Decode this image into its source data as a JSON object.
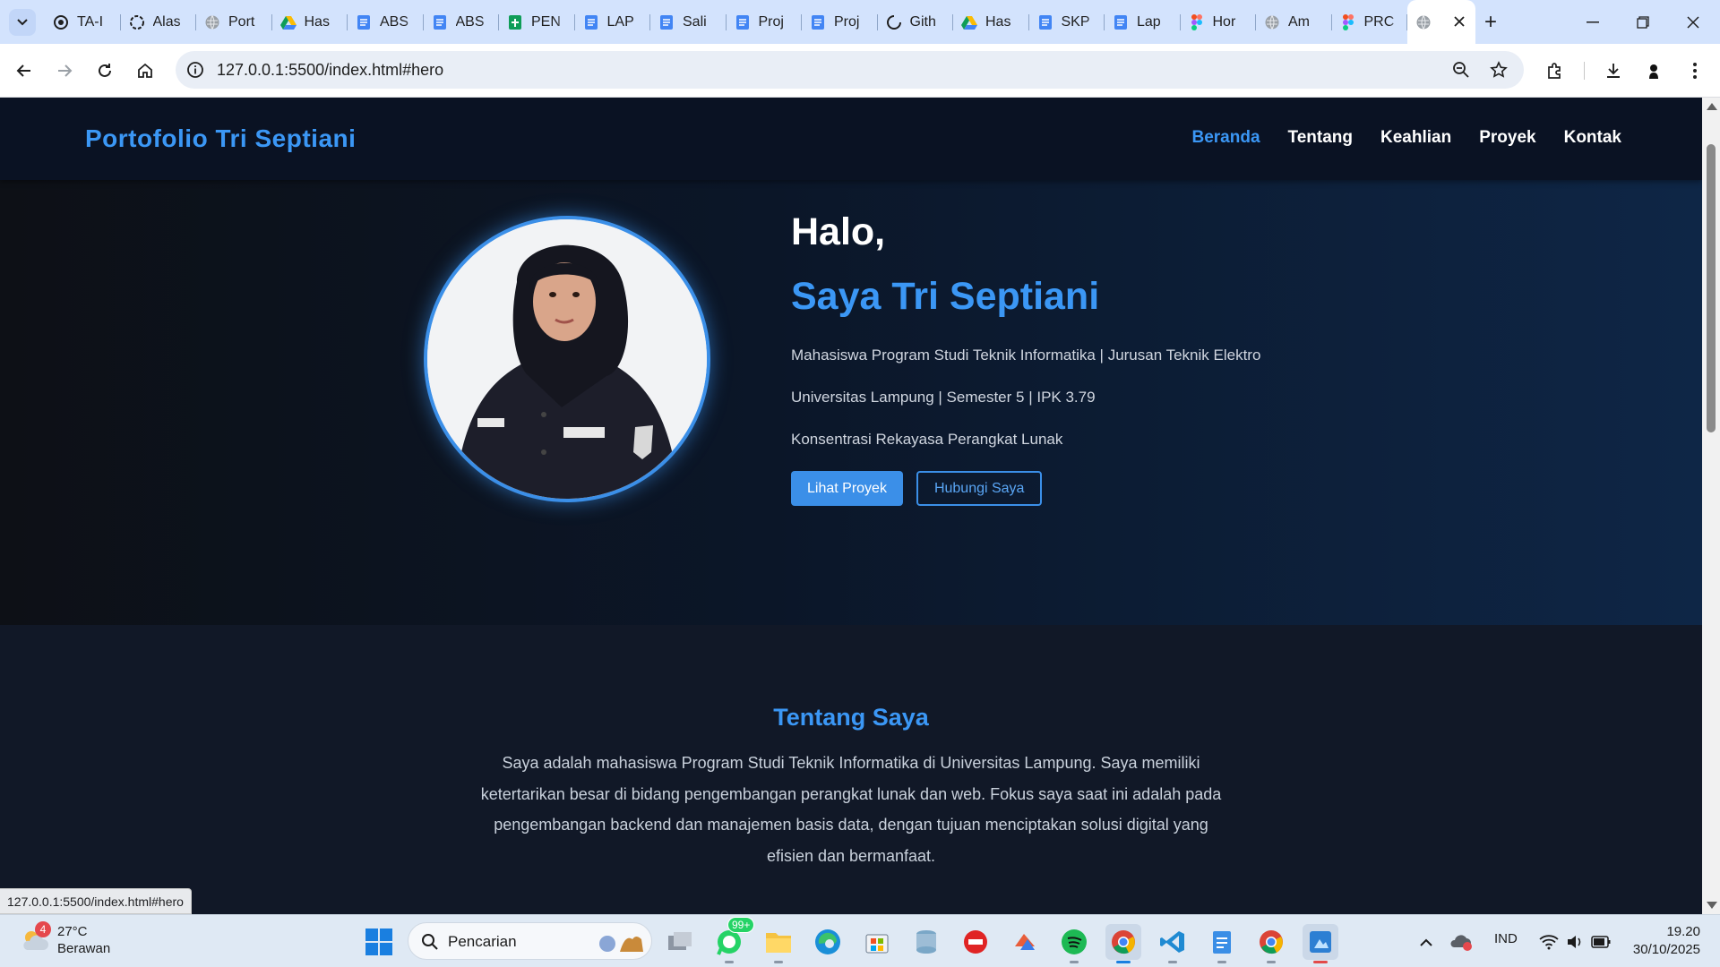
{
  "browser": {
    "tabs": [
      {
        "title": "TA-I",
        "icon": "github-copilot-icon"
      },
      {
        "title": "Alas",
        "icon": "chatgpt-icon"
      },
      {
        "title": "Port",
        "icon": "globe-icon"
      },
      {
        "title": "Has",
        "icon": "google-drive-icon"
      },
      {
        "title": "ABS",
        "icon": "google-docs-icon"
      },
      {
        "title": "ABS",
        "icon": "google-docs-icon"
      },
      {
        "title": "PEN",
        "icon": "google-sheets-icon"
      },
      {
        "title": "LAP",
        "icon": "google-docs-icon"
      },
      {
        "title": "Sali",
        "icon": "google-docs-icon"
      },
      {
        "title": "Proj",
        "icon": "google-docs-icon"
      },
      {
        "title": "Proj",
        "icon": "google-docs-icon"
      },
      {
        "title": "Gith",
        "icon": "loading-icon"
      },
      {
        "title": "Has",
        "icon": "google-drive-icon"
      },
      {
        "title": "SKP",
        "icon": "google-docs-icon"
      },
      {
        "title": "Lap",
        "icon": "google-docs-icon"
      },
      {
        "title": "Hor",
        "icon": "figma-icon"
      },
      {
        "title": "Am",
        "icon": "globe-icon"
      },
      {
        "title": "PRC",
        "icon": "figma-icon"
      }
    ],
    "active_tab_icon": "globe-icon",
    "url": "127.0.0.1:5500/index.html#hero",
    "status_url": "127.0.0.1:5500/index.html#hero"
  },
  "site": {
    "logo": "Portofolio Tri Septiani",
    "nav": [
      "Beranda",
      "Tentang",
      "Keahlian",
      "Proyek",
      "Kontak"
    ],
    "hero": {
      "greeting": "Halo,",
      "name": "Saya Tri Septiani",
      "line1": "Mahasiswa Program Studi Teknik Informatika | Jurusan Teknik Elektro",
      "line2": "Universitas Lampung | Semester 5 | IPK 3.79",
      "line3": "Konsentrasi Rekayasa Perangkat Lunak",
      "btn_primary": "Lihat Proyek",
      "btn_secondary": "Hubungi Saya"
    },
    "about": {
      "title": "Tentang Saya",
      "text": "Saya adalah mahasiswa Program Studi Teknik Informatika di Universitas Lampung. Saya memiliki ketertarikan besar di bidang pengembangan perangkat lunak dan web. Fokus saya saat ini adalah pada pengembangan backend dan manajemen basis data, dengan tujuan menciptakan solusi digital yang efisien dan bermanfaat."
    },
    "accent_color": "#3b97f5"
  },
  "taskbar": {
    "weather_temp": "27°C",
    "weather_desc": "Berawan",
    "weather_badge": "4",
    "search_placeholder": "Pencarian",
    "whatsapp_badge": "99+",
    "language": "IND",
    "time": "19.20",
    "date": "30/10/2025"
  }
}
